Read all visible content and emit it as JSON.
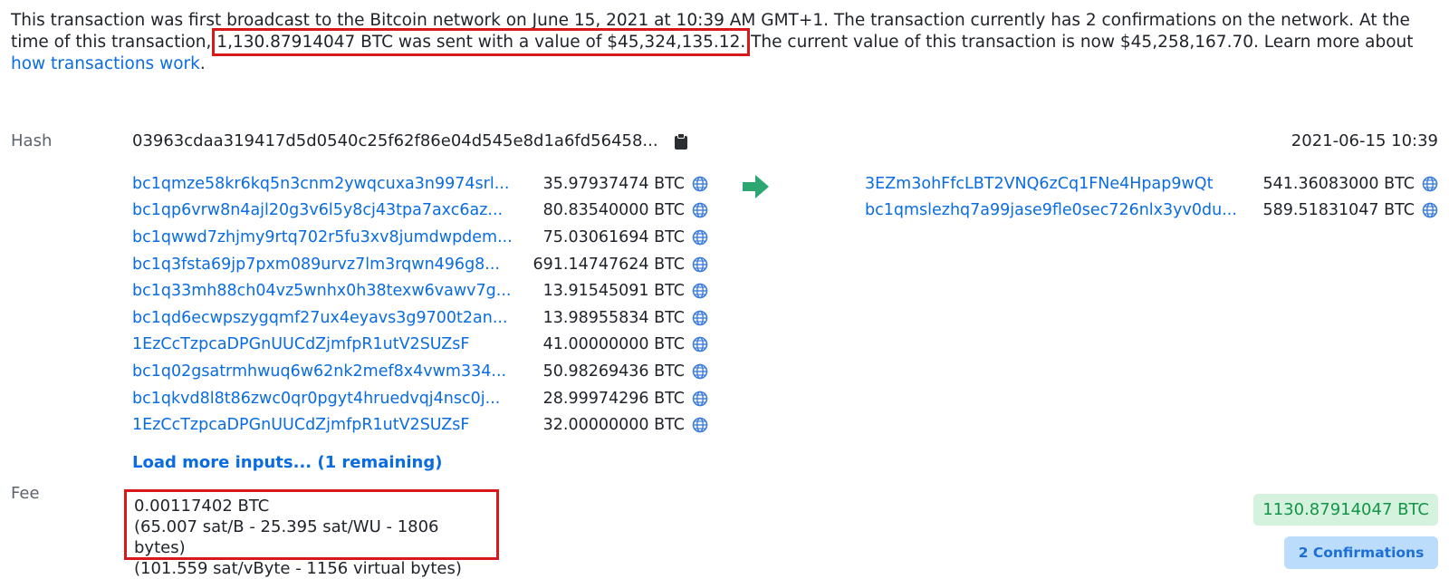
{
  "intro": {
    "part1": "This transaction was first broadcast to the Bitcoin network on June 15, 2021 at 10:39 AM GMT+1.  The transaction currently has 2 confirmations on the network.  At the time of this transaction, ",
    "highlight": "1,130.87914047 BTC was sent with a value of $45,324,135.12.",
    "part2": " The current value of this transaction is now $45,258,167.70.  Learn more about ",
    "link": "how transactions work",
    "end": "."
  },
  "hash": {
    "label": "Hash",
    "value": "03963cdaa319417d5d0540c25f62f86e04d545e8d1a6fd56458...",
    "timestamp": "2021-06-15 10:39"
  },
  "inputs": [
    {
      "address": "bc1qmze58kr6kq5n3cnm2ywqcuxa3n9974srl...",
      "amount": "35.97937474 BTC"
    },
    {
      "address": "bc1qp6vrw8n4ajl20g3v6l5y8cj43tpa7axc6az...",
      "amount": "80.83540000 BTC"
    },
    {
      "address": "bc1qwwd7zhjmy9rtq702r5fu3xv8jumdwpdem...",
      "amount": "75.03061694 BTC"
    },
    {
      "address": "bc1q3fsta69jp7pxm089urvz7lm3rqwn496g8...",
      "amount": "691.14747624 BTC"
    },
    {
      "address": "bc1q33mh88ch04vz5wnhx0h38texw6vawv7g...",
      "amount": "13.91545091 BTC"
    },
    {
      "address": "bc1qd6ecwpszygqmf27ux4eyavs3g9700t2an...",
      "amount": "13.98955834 BTC"
    },
    {
      "address": "1EzCcTzpcaDPGnUUCdZjmfpR1utV2SUZsF",
      "amount": "41.00000000 BTC"
    },
    {
      "address": "bc1q02gsatrmhwuq6w62nk2mef8x4vwm334...",
      "amount": "50.98269436 BTC"
    },
    {
      "address": "bc1qkvd8l8t86zwc0qr0pgyt4hruedvqj4nsc0j...",
      "amount": "28.99974296 BTC"
    },
    {
      "address": "1EzCcTzpcaDPGnUUCdZjmfpR1utV2SUZsF",
      "amount": "32.00000000 BTC"
    }
  ],
  "outputs": [
    {
      "address": "3EZm3ohFfcLBT2VNQ6zCq1FNe4Hpap9wQt",
      "amount": "541.36083000 BTC"
    },
    {
      "address": "bc1qmslezhq7a99jase9fle0sec726nlx3yv0du...",
      "amount": "589.51831047 BTC"
    }
  ],
  "load_more": "Load more inputs... (1 remaining)",
  "fee": {
    "label": "Fee",
    "btc": "0.00117402 BTC",
    "rate_line": "(65.007 sat/B - 25.395 sat/WU - 1806 bytes)",
    "vbyte_line": "(101.559 sat/vByte - 1156 virtual bytes)"
  },
  "summary": {
    "total": "1130.87914047 BTC",
    "confirmations": "2 Confirmations"
  },
  "colors": {
    "link": "#0a6ce0",
    "highlight_border": "#d7191c",
    "arrow": "#2da771",
    "total_badge_bg": "#d5f2df",
    "total_badge_text": "#139447",
    "conf_badge_bg": "#bcdcfb",
    "conf_badge_text": "#1c6fd6"
  },
  "icons": {
    "copy": "clipboard-icon",
    "address": "globe-icon",
    "flow": "arrow-right-icon"
  }
}
